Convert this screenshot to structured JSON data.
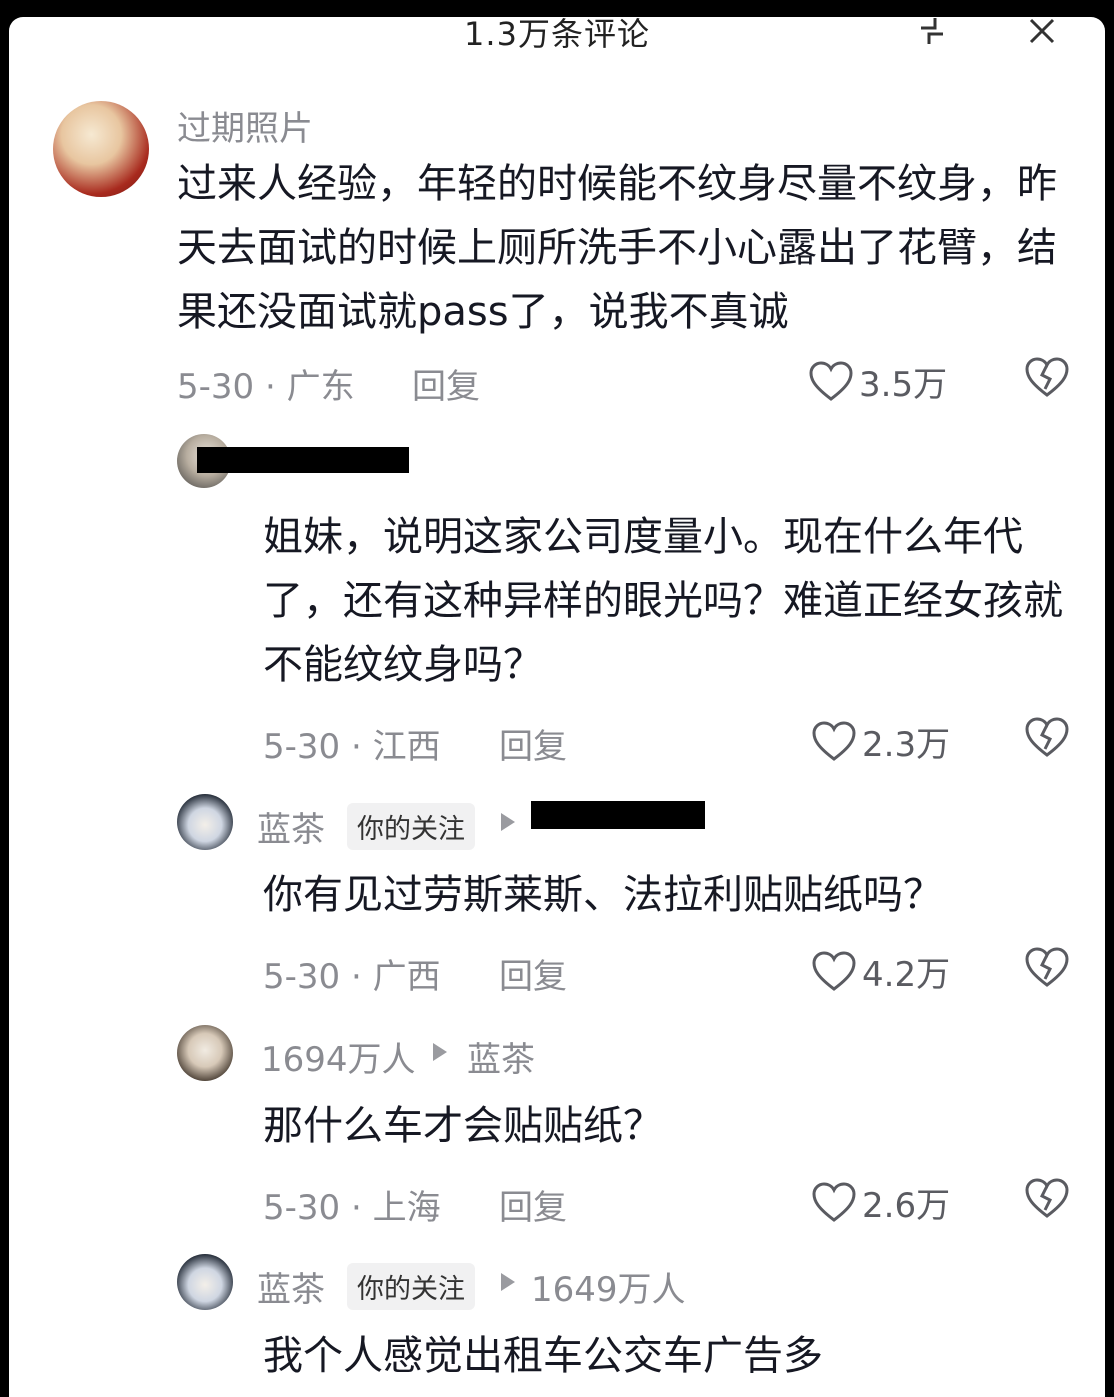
{
  "header": {
    "title": "1.3万条评论"
  },
  "comments": [
    {
      "name": "过期照片",
      "content": "过来人经验，年轻的时候能不纹身尽量不纹身，昨天去面试的时候上厕所洗手不小心露出了花臂，结果还没面试就pass了，说我不真诚",
      "date": "5-30",
      "region": "广东",
      "reply_label": "回复",
      "likes": "3.5万"
    },
    {
      "name": "",
      "content": "姐妹，说明这家公司度量小。现在什么年代了，还有这种异样的眼光吗？难道正经女孩就不能纹纹身吗？",
      "date": "5-30",
      "region": "江西",
      "reply_label": "回复",
      "likes": "2.3万"
    },
    {
      "name": "蓝茶",
      "tag": "你的关注",
      "content": "你有见过劳斯莱斯、法拉利贴贴纸吗？",
      "date": "5-30",
      "region": "广西",
      "reply_label": "回复",
      "likes": "4.2万"
    },
    {
      "name": "1694万人",
      "reply_to": "蓝茶",
      "content": "那什么车才会贴贴纸？",
      "date": "5-30",
      "region": "上海",
      "reply_label": "回复",
      "likes": "2.6万"
    },
    {
      "name": "蓝茶",
      "tag": "你的关注",
      "reply_to": "1649万人",
      "content": "我个人感觉出租车公交车广告多"
    }
  ],
  "colors": {
    "meta": "#8a8b91",
    "text": "#161823",
    "tag_bg": "#f1f1f2"
  },
  "icons": [
    "collapse-icon",
    "close-icon",
    "heart-icon",
    "broken-heart-icon",
    "reply-arrow-icon"
  ]
}
